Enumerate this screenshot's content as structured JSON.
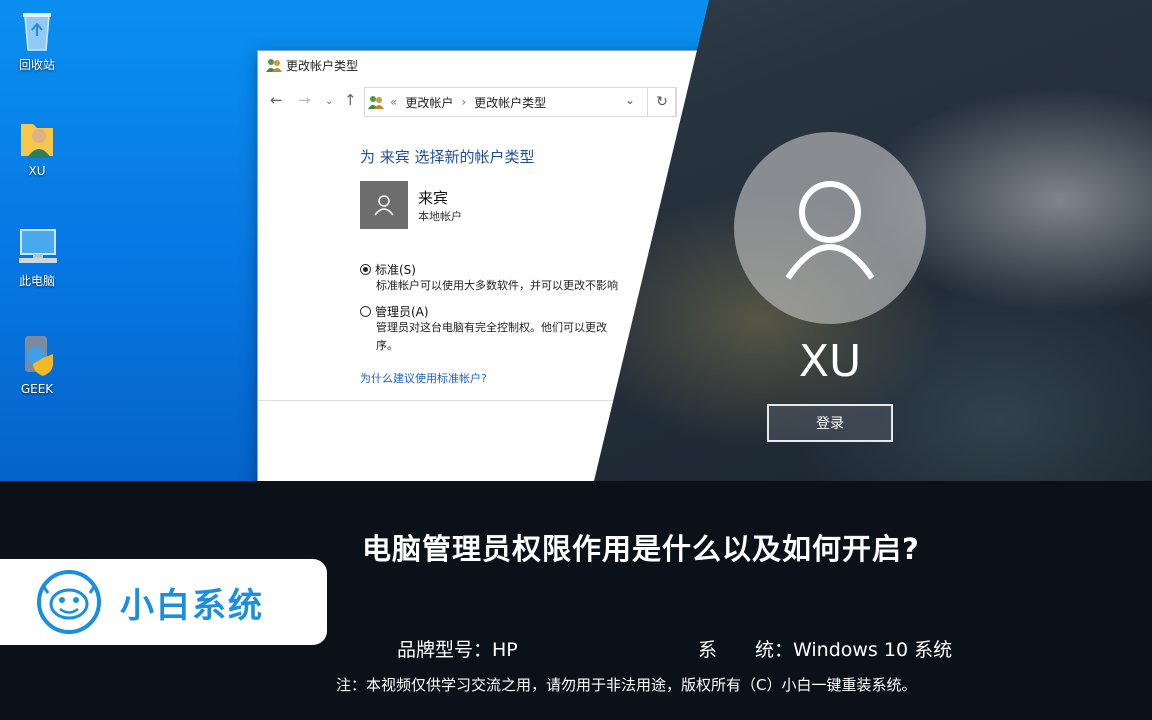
{
  "desktop": {
    "icons": [
      {
        "label": "回收站"
      },
      {
        "label": "XU"
      },
      {
        "label": "此电脑"
      },
      {
        "label": "GEEK"
      }
    ]
  },
  "window": {
    "title": "更改帐户类型",
    "breadcrumb": [
      "更改帐户",
      "更改帐户类型"
    ],
    "breadcrumb_prefix": "«",
    "heading": "为 来宾 选择新的帐户类型",
    "account": {
      "name": "来宾",
      "type": "本地帐户"
    },
    "options": [
      {
        "label": "标准(S)",
        "selected": true,
        "desc": [
          "标准帐户可以使用大多数软件，并可以更改不影响"
        ]
      },
      {
        "label": "管理员(A)",
        "selected": false,
        "desc": [
          "管理员对这台电脑有完全控制权。他们可以更改",
          "序。"
        ]
      }
    ],
    "help_link": "为什么建议使用标准帐户?"
  },
  "login": {
    "username": "XU",
    "signin_label": "登录"
  },
  "banner": {
    "title": "电脑管理员权限作用是什么以及如何开启?",
    "brand": "小白系统",
    "brand_model_label": "品牌型号：HP",
    "system_label": "系　　统：Windows 10 系统",
    "note": "注：本视频仅供学习交流之用，请勿用于非法用途，版权所有（C）小白一键重装系统。"
  },
  "colors": {
    "desktop_blue": "#0a8ff0",
    "link_blue": "#1a64c8",
    "heading_blue": "#1e4f9c",
    "brand_blue": "#1a8ee0",
    "banner_bg": "#0b1119"
  }
}
